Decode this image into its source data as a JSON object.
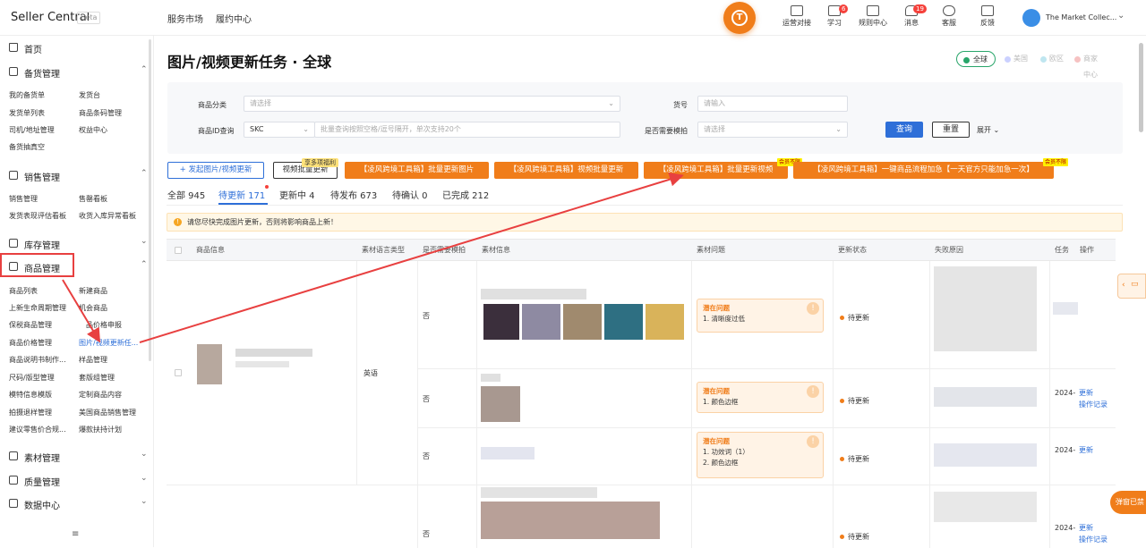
{
  "topbar": {
    "brand": "Seller Central",
    "beta": "Beta",
    "nav": [
      "服务市场",
      "履约中心"
    ],
    "tools": [
      {
        "label": "运营对接",
        "icon": "chat-icon",
        "badge": ""
      },
      {
        "label": "学习",
        "icon": "book-icon",
        "badge": "6"
      },
      {
        "label": "规则中心",
        "icon": "document-icon",
        "badge": ""
      },
      {
        "label": "消息",
        "icon": "bell-icon",
        "badge": "19"
      },
      {
        "label": "客服",
        "icon": "headset-icon",
        "badge": ""
      },
      {
        "label": "反馈",
        "icon": "feedback-icon",
        "badge": ""
      }
    ],
    "shop_name": "The Market Collec..."
  },
  "sidebar": {
    "sections": [
      {
        "label": "首页",
        "icon": "home-icon",
        "arrow": ""
      },
      {
        "label": "备货管理",
        "icon": "clipboard-icon",
        "arrow": "^"
      },
      {
        "label": "销售管理",
        "icon": "chart-icon",
        "arrow": "^"
      },
      {
        "label": "库存管理",
        "icon": "warehouse-icon",
        "arrow": "v"
      },
      {
        "label": "商品管理",
        "icon": "box-icon",
        "arrow": "^"
      },
      {
        "label": "素材管理",
        "icon": "image-icon",
        "arrow": "v"
      },
      {
        "label": "质量管理",
        "icon": "shield-icon",
        "arrow": "v"
      },
      {
        "label": "数据中心",
        "icon": "data-icon",
        "arrow": "v"
      }
    ],
    "stock_items": [
      "我的备货单",
      "发货台",
      "发货单列表",
      "商品条码管理",
      "司机/地址管理",
      "权益中心",
      "备货抽真空"
    ],
    "sales_items": [
      "销售管理",
      "售罄看板",
      "发货表现评估看板",
      "收货入库异常看板"
    ],
    "goods_items": [
      "商品列表",
      "新建商品",
      "上新生命周期管理",
      "机会商品",
      "保税商品管理",
      "品价格申报",
      "商品价格管理",
      "图片/视频更新任...",
      "商品说明书制作...",
      "样品管理",
      "尺码/版型管理",
      "套版组管理",
      "模特信息模版",
      "定制商品内容",
      "拍摄退样管理",
      "美国商品销售管理",
      "建议零售价合规...",
      "爆款扶持计划"
    ]
  },
  "page": {
    "title": "图片/视频更新任务 · 全球",
    "regions": [
      "全球",
      "美国",
      "欧区",
      "商家中心"
    ]
  },
  "filters": {
    "category_label": "商品分类",
    "category_placeholder": "请选择",
    "sku_label": "货号",
    "sku_placeholder": "请输入",
    "id_label": "商品ID查询",
    "id_type": "SKC",
    "id_placeholder": "批量查询按照空格/逗号隔开，单次支持20个",
    "need_shoot_label": "是否需要模拍",
    "need_shoot_placeholder": "请选择",
    "query": "查询",
    "reset": "重置",
    "expand": "展开"
  },
  "actions": {
    "start": "+ 发起图片/视频更新",
    "video_batch": "视频批量更新",
    "promo_tag": "享多项福利",
    "tool1": "【凌风跨境工具箱】批量更新图片",
    "tool2": "【凌风跨境工具箱】视频批量更新",
    "tool3": "【凌风跨境工具箱】批量更新视频",
    "tool4": "【凌风跨境工具箱】一键商品流程加急【一天官方只能加急一次】",
    "member_tag": "会员不限"
  },
  "tabs": [
    "全部 945",
    "待更新 171",
    "更新中 4",
    "待发布 673",
    "待确认 0",
    "已完成 212"
  ],
  "notice": "请您尽快完成图片更新，否则将影响商品上新！",
  "table": {
    "headers": [
      "商品信息",
      "素材语言类型",
      "是否需要模拍",
      "素材信息",
      "素材问题",
      "更新状态",
      "失败原因",
      "任务",
      "操作"
    ],
    "language": "英语",
    "rows": [
      {
        "need_shoot": "否",
        "issue_title": "潜在问题",
        "issues": [
          "1. 清晰度过低"
        ],
        "status": "待更新",
        "date": "",
        "ops": []
      },
      {
        "need_shoot": "否",
        "issue_title": "潜在问题",
        "issues": [
          "1. 颜色边框"
        ],
        "status": "待更新",
        "date": "2024-",
        "ops": [
          "更新",
          "操作记录"
        ]
      },
      {
        "need_shoot": "否",
        "issue_title": "潜在问题",
        "issues": [
          "1. 功效词（1）",
          "2. 颜色边框"
        ],
        "status": "待更新",
        "date": "2024-",
        "ops": [
          "更新"
        ]
      },
      {
        "need_shoot": "否",
        "issue_title": "",
        "issues": [],
        "status": "待更新",
        "date": "2024-",
        "ops": [
          "更新",
          "操作记录"
        ]
      }
    ]
  },
  "float": {
    "popup": "弹窗已禁"
  },
  "colors": {
    "primary": "#2e6fd8",
    "orange": "#f07d1a",
    "green": "#28a56a",
    "red": "#e84040"
  }
}
